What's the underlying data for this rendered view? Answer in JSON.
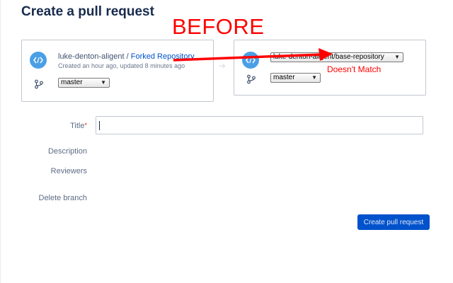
{
  "page": {
    "title": "Create a pull request"
  },
  "annotations": {
    "before": "BEFORE",
    "mismatch": "Doesn't Match",
    "arrow_color": "#ff0000"
  },
  "source": {
    "owner": "luke-denton-aligent",
    "separator": " / ",
    "repo": "Forked Repository",
    "meta": "Created an hour ago, updated 8 minutes ago",
    "branch": "master",
    "icon": "code-icon",
    "branch_icon": "branch-icon"
  },
  "destination": {
    "repository": "luke-denton-aligent/base-repository",
    "branch": "master",
    "icon": "code-icon",
    "branch_icon": "branch-icon"
  },
  "form": {
    "title_label": "Title",
    "required_mark": "*",
    "title_value": "",
    "description_label": "Description",
    "reviewers_label": "Reviewers",
    "delete_branch_label": "Delete branch",
    "submit_label": "Create pull request"
  },
  "colors": {
    "accent": "#0052cc",
    "repo_avatar": "#4a9fe6",
    "annotation": "#ff0000"
  }
}
